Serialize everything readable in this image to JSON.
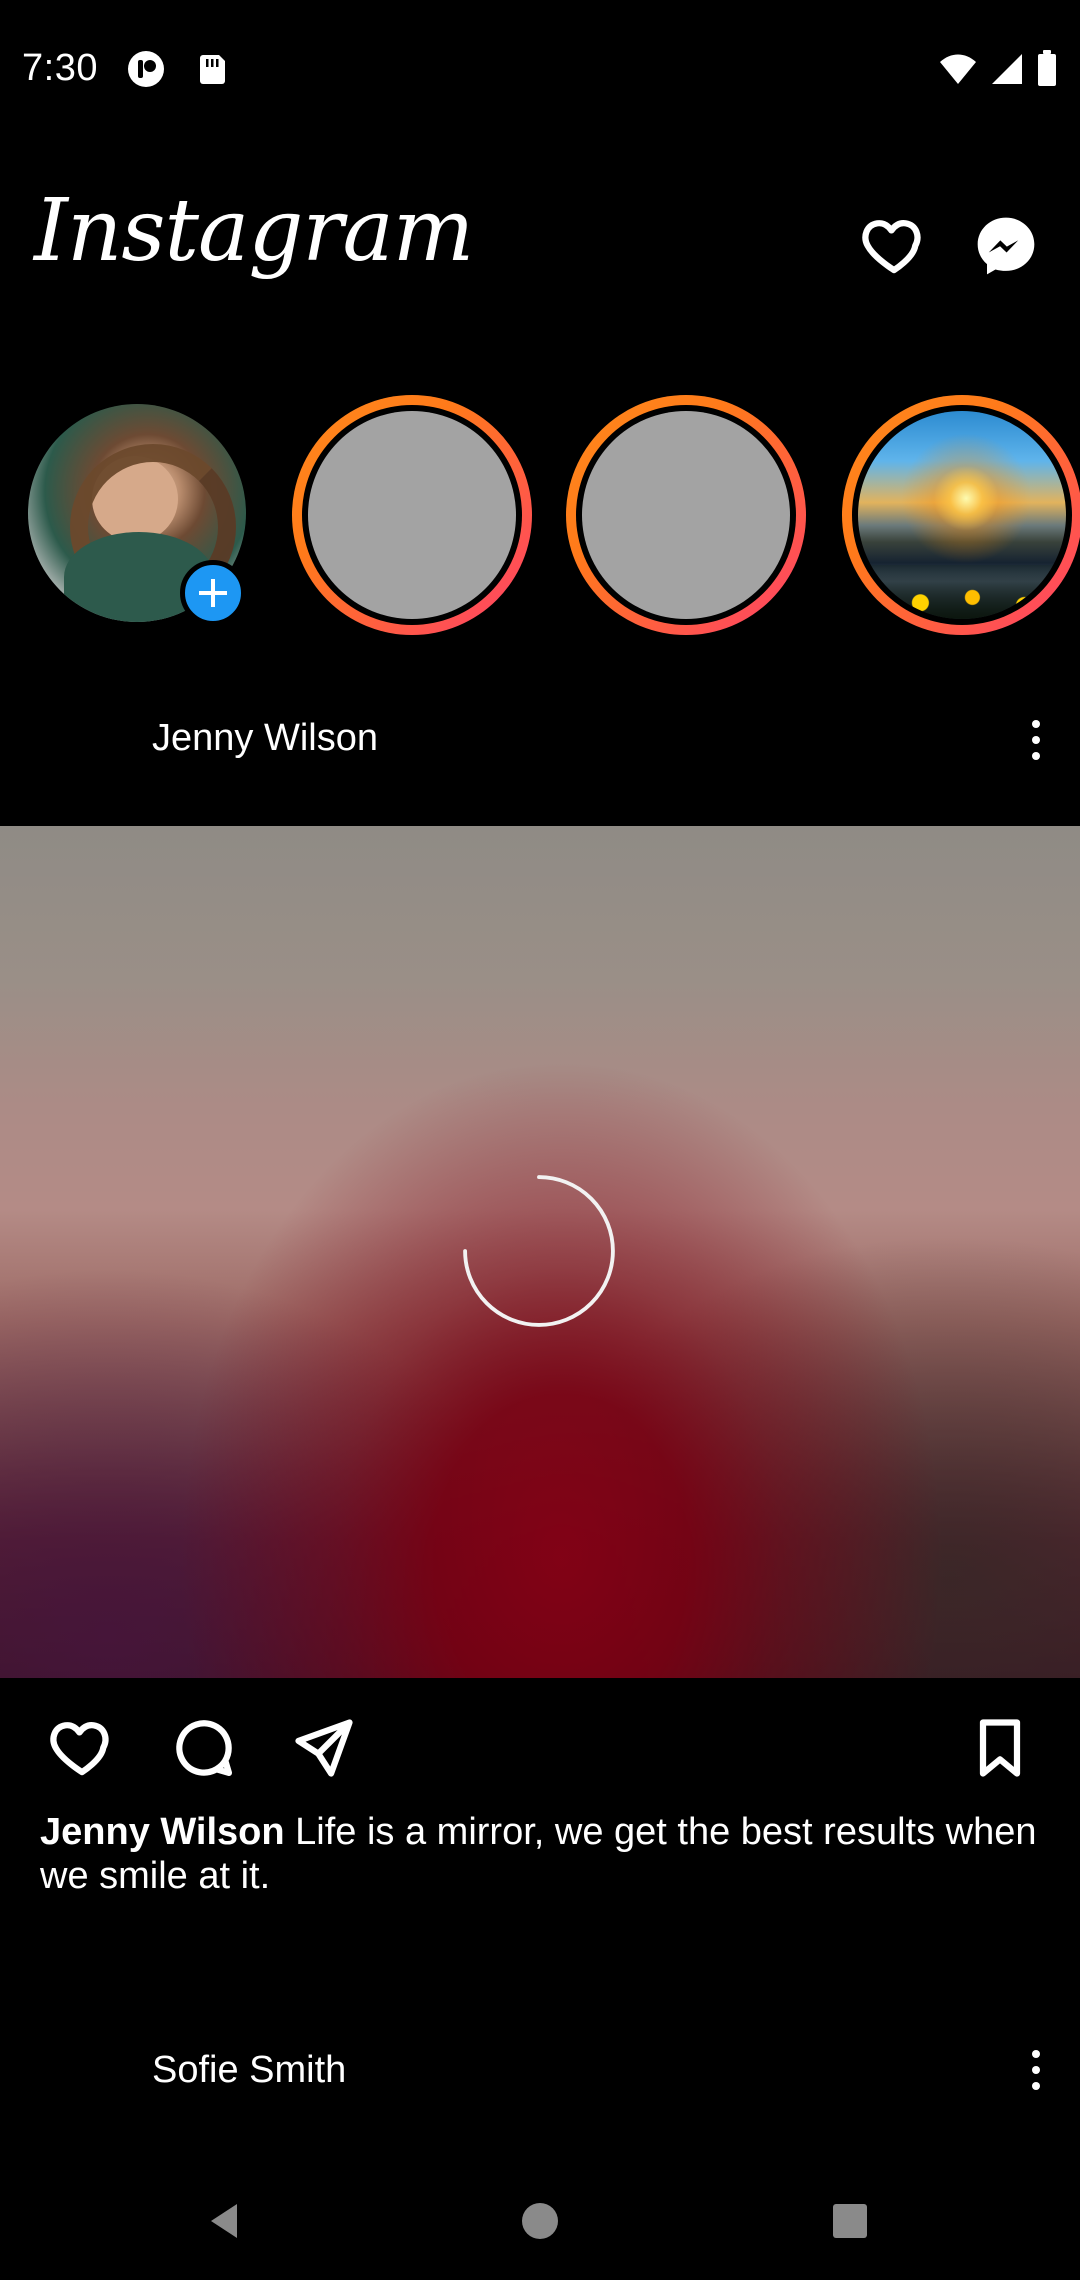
{
  "status_bar": {
    "time": "7:30",
    "left_icons": [
      "parental-controls-icon",
      "sd-card-icon"
    ],
    "right_icons": [
      "wifi-icon",
      "signal-icon",
      "battery-icon"
    ]
  },
  "header": {
    "brand": "Instagram",
    "actions": [
      "heart-icon",
      "messenger-icon"
    ]
  },
  "stories": [
    {
      "type": "own",
      "has_add_button": true
    },
    {
      "type": "placeholder"
    },
    {
      "type": "placeholder"
    },
    {
      "type": "landscape"
    }
  ],
  "posts": [
    {
      "username": "Jenny Wilson",
      "caption_username": "Jenny Wilson",
      "caption_text": " Life is a mirror, we get the best results when we smile at it."
    },
    {
      "username": "Sofie Smith"
    }
  ],
  "post_actions": [
    "like-icon",
    "comment-icon",
    "share-icon",
    "bookmark-icon"
  ],
  "nav_bar": [
    "back-icon",
    "home-icon",
    "recents-icon"
  ],
  "colors": {
    "background": "#000000",
    "accent_blue": "#1d97f3",
    "story_ring_start": "#ff8a1c",
    "story_ring_end": "#ff3f6b"
  }
}
